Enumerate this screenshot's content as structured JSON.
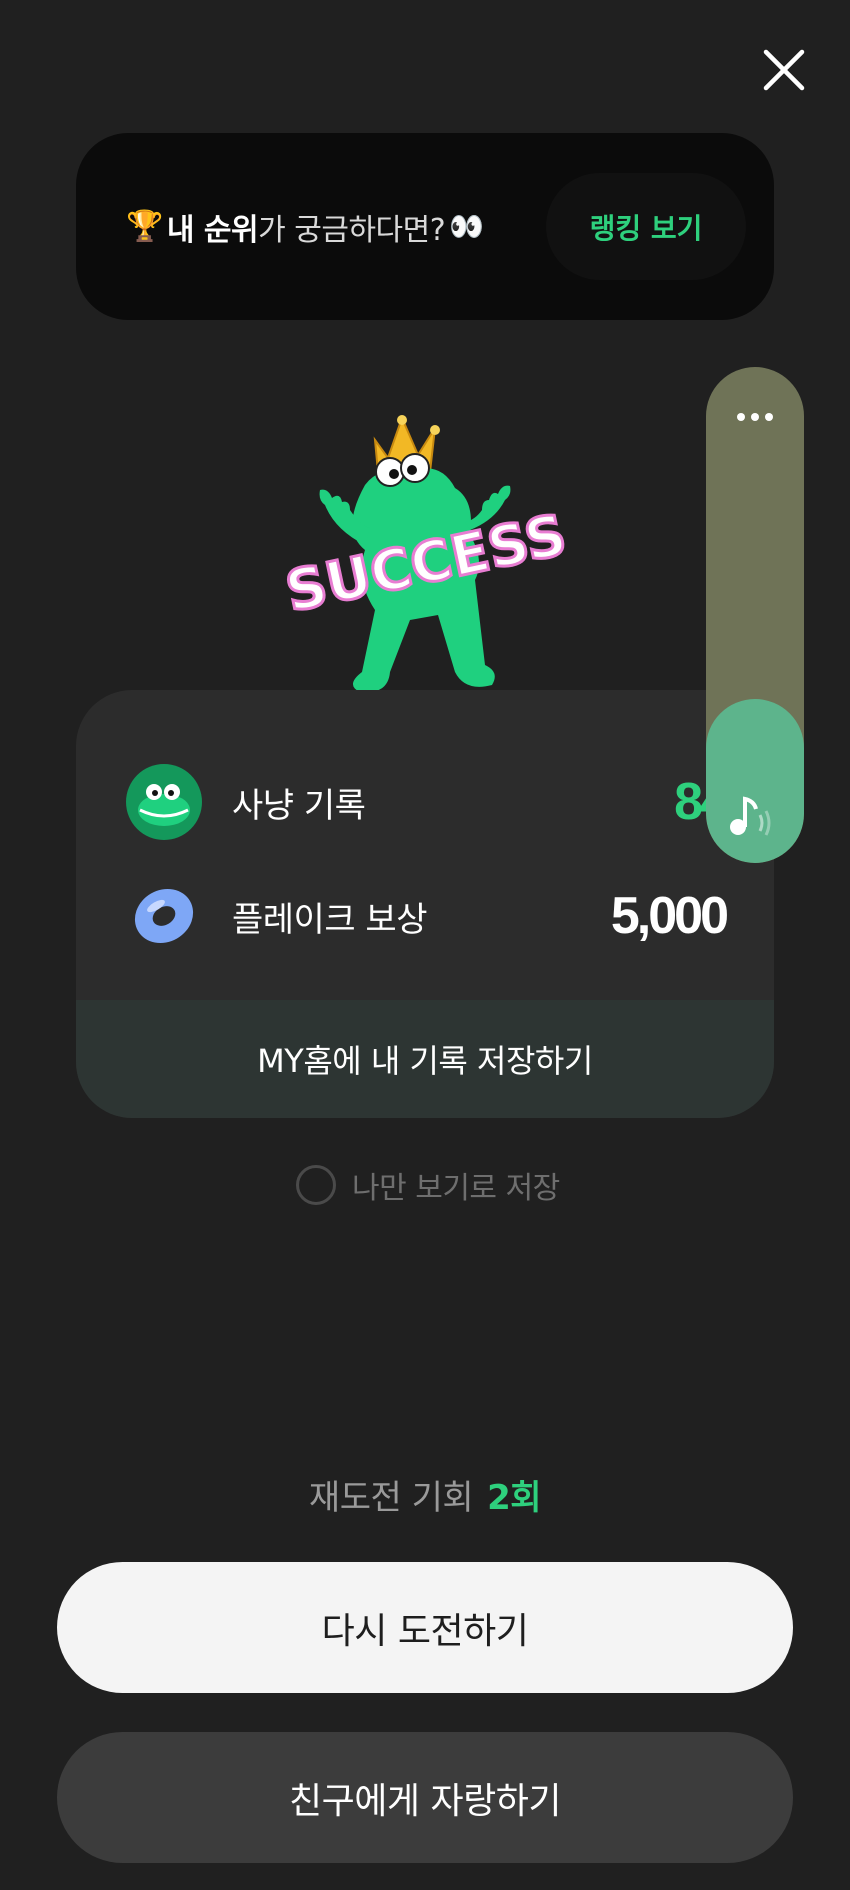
{
  "rank_banner": {
    "trophy_emoji": "🏆",
    "text_bold": "내 순위",
    "text_rest": "가 궁금하다면?",
    "eyes_emoji": "👀",
    "button_label": "랭킹 보기"
  },
  "mascot": {
    "badge_text": "SUCCESS"
  },
  "result": {
    "hunt_record_label": "사냥 기록",
    "hunt_record_value": "84",
    "reward_label": "플레이크 보상",
    "reward_value": "5,000",
    "save_home_label": "MY홈에 내 기록 저장하기"
  },
  "private_save": {
    "label": "나만 보기로 저장",
    "checked": false
  },
  "side_widget": {
    "level": 0.33
  },
  "retry": {
    "label": "재도전 기회",
    "count": "2회"
  },
  "buttons": {
    "retry_label": "다시 도전하기",
    "share_label": "친구에게 자랑하기"
  },
  "colors": {
    "accent": "#2ed07d",
    "background": "#202020",
    "card": "#2c2c2c"
  }
}
